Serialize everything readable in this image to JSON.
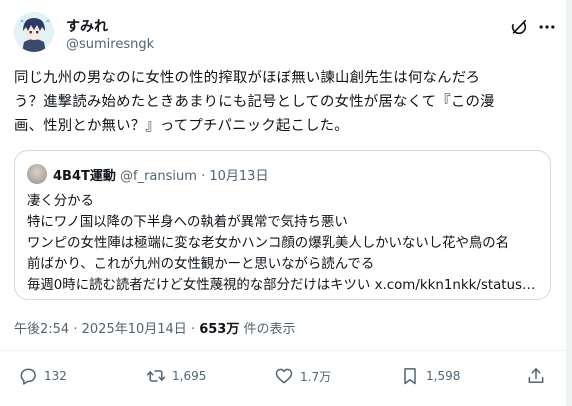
{
  "author": {
    "name": "すみれ",
    "handle": "@sumiresngk"
  },
  "post": {
    "lines": [
      "同じ九州の男なのに女性の性的搾取がほぼ無い諫山創先生は何なんだろ",
      "う？進撃読み始めたときあまりにも記号としての女性が居なくて『この漫",
      "画、性別とか無い？』ってプチパニック起こした。"
    ]
  },
  "quote": {
    "name": "4B4T運動",
    "handle": "@f_ransium",
    "separator": "·",
    "date": "10月13日",
    "lines": [
      "凄く分かる",
      "特にワノ国以降の下半身への執着が異常で気持ち悪い",
      "ワンピの女性陣は極端に変な老女かハンコ顔の爆乳美人しかいないし花や鳥の名",
      "前ばかり、これが九州の女性観かーと思いながら読んでる"
    ],
    "last_line_text": "毎週0時に読む読者だけど女性蔑視的な部分だけはキツい",
    "link": "x.com/kkn1nkk/status…"
  },
  "meta": {
    "time": "午後2:54",
    "separator": "·",
    "date": "2025年10月14日",
    "separator2": "·",
    "views": "653万",
    "views_label": "件の表示"
  },
  "actions": {
    "replies": "132",
    "reposts": "1,695",
    "likes": "1.7万",
    "bookmarks": "1,598"
  },
  "icons": [
    "grok-icon",
    "more-icon",
    "reply-icon",
    "repost-icon",
    "like-icon",
    "bookmark-icon",
    "share-icon"
  ],
  "colors": {
    "text": "#0f1419",
    "secondary": "#536471",
    "border": "#cfd9de"
  }
}
